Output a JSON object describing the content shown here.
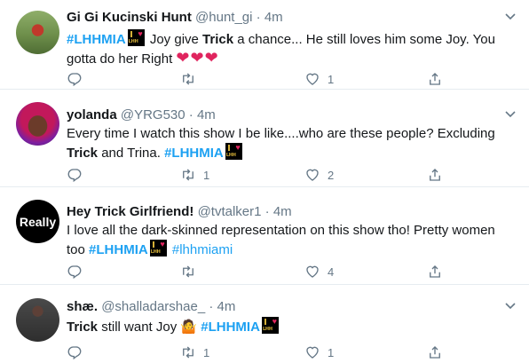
{
  "tweets": [
    {
      "name": "Gi Gi Kucinski Hunt",
      "handle": "@hunt_gi",
      "dot": "·",
      "time": "4m",
      "hashtag": "#LHHMIA",
      "text1": " Joy give ",
      "bold1": "Trick",
      "text2": " a chance... He still loves him some Joy. You gotta do her Right ",
      "hearts": "❤❤❤",
      "counts": {
        "reply": "",
        "retweet": "",
        "like": "1"
      }
    },
    {
      "name": "yolanda",
      "handle": "@YRG530",
      "dot": "·",
      "time": "4m",
      "text1": "Every time I watch this show I be like....who are these people? Excluding ",
      "bold1": "Trick",
      "text2": " and Trina. ",
      "hashtag": "#LHHMIA",
      "counts": {
        "reply": "",
        "retweet": "1",
        "like": "2"
      }
    },
    {
      "name": "Hey Trick Girlfriend!",
      "handle": "@tvtalker1",
      "dot": "·",
      "time": "4m",
      "avatar_text": "Really",
      "text1": "I love all the dark-skinned representation on this show tho! Pretty women too ",
      "hashtag": "#LHHMIA",
      "hashtag2": "#lhhmiami",
      "counts": {
        "reply": "",
        "retweet": "",
        "like": "4"
      }
    },
    {
      "name": "shæ.",
      "handle": "@shalladarshae_",
      "dot": "·",
      "time": "4m",
      "bold1": "Trick",
      "text1": " still want Joy ",
      "emoji": "🤷",
      "hashtag": "#LHHMIA",
      "counts": {
        "reply": "",
        "retweet": "1",
        "like": "1"
      }
    }
  ],
  "badge": {
    "letters": "LHH",
    "heart": "♥"
  },
  "colors": {
    "accent": "#1da1f2",
    "muted": "#657786",
    "heart": "#e0245e",
    "divider": "#e6ecf0"
  },
  "icons": [
    "reply-icon",
    "retweet-icon",
    "like-icon",
    "share-icon",
    "chevron-down-icon"
  ]
}
